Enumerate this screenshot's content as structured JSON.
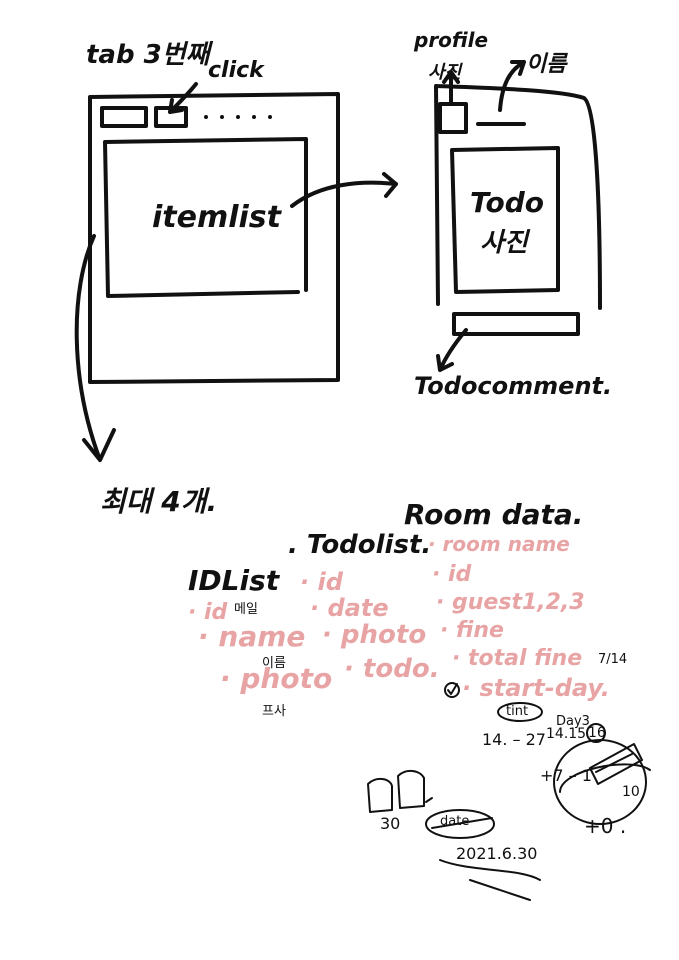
{
  "left_mockup": {
    "title": "tab 3번째",
    "click_label": "click",
    "item_label": "itemlist",
    "max_note": "최대 4개."
  },
  "right_mockup": {
    "profile_label": "profile",
    "photo_label": "사진",
    "name_label": "이름",
    "todo_line1": "Todo",
    "todo_line2": "사진",
    "comment_label": "Todocomment."
  },
  "data_lists": {
    "idlist": {
      "title": "IDList",
      "items": [
        "· id",
        "· name",
        "· photo"
      ],
      "notes": [
        "메일",
        "이름",
        "프사"
      ]
    },
    "todolist": {
      "title": ". Todolist.",
      "items": [
        "· id",
        "· date",
        "· photo",
        "· todo."
      ]
    },
    "roomdata": {
      "title": "Room data.",
      "items": [
        "· room name",
        "· id",
        "· guest1,2,3",
        "· fine",
        "· total fine",
        "· start-day."
      ],
      "start_note": "7/14"
    }
  },
  "scribbles": {
    "tint": "tint",
    "day": "Day3",
    "nums1": "14. – 27",
    "nums2": "14.15",
    "circled": "16",
    "minus": "+7 – 1",
    "thirty": "30",
    "date_word": "date",
    "date_value": "2021.6.30",
    "bottom_right": "+0 .",
    "ten": "10"
  },
  "colors": {
    "ink": "#111111",
    "pink": "#e8a4a4",
    "background": "#ffffff"
  }
}
